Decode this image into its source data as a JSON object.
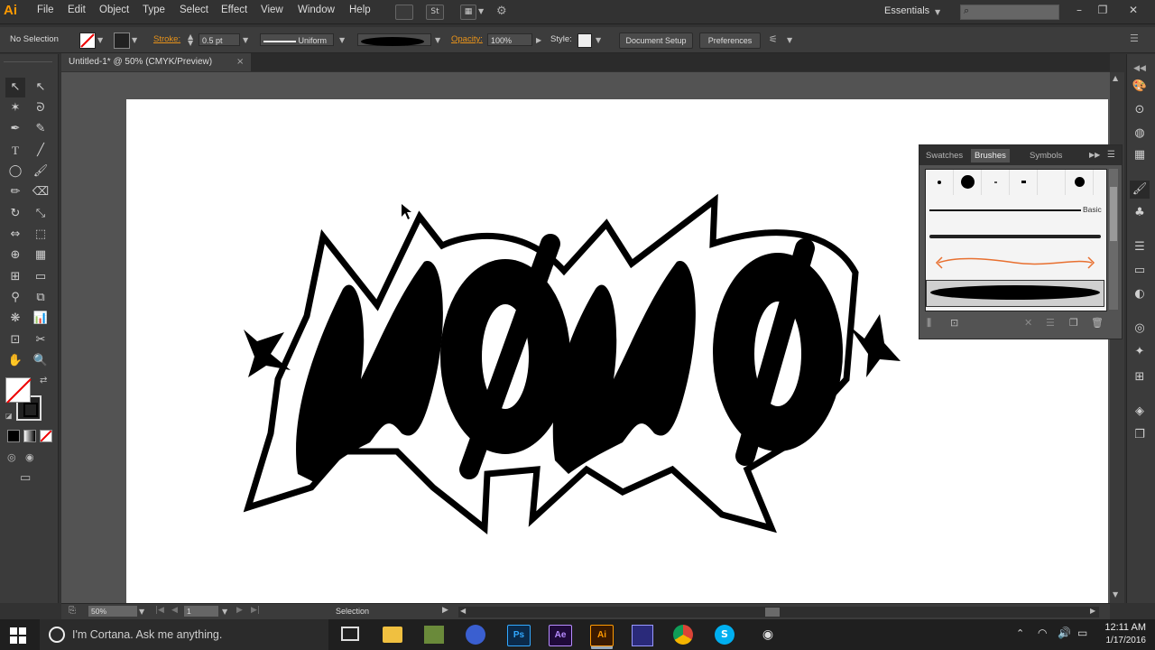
{
  "app": {
    "logo": "Ai"
  },
  "menu": [
    "File",
    "Edit",
    "Object",
    "Type",
    "Select",
    "Effect",
    "View",
    "Window",
    "Help"
  ],
  "toolbar": {
    "bridge_label": "St",
    "workspace": "Essentials"
  },
  "control_bar": {
    "selection_state": "No Selection",
    "stroke_label": "Stroke:",
    "stroke_weight": "0.5 pt",
    "stroke_profile": "Uniform",
    "opacity_label": "Opacity:",
    "opacity_value": "100%",
    "style_label": "Style:",
    "document_setup": "Document Setup",
    "preferences": "Preferences"
  },
  "document_tab": {
    "title": "Untitled-1* @ 50% (CMYK/Preview)",
    "close": "×"
  },
  "brushes_panel": {
    "tabs": [
      "Swatches",
      "Brushes",
      "Symbols"
    ],
    "active_tab": "Brushes",
    "basic_label": "Basic"
  },
  "status_bar": {
    "zoom": "50%",
    "artboard": "1",
    "tool": "Selection"
  },
  "taskbar": {
    "cortana_placeholder": "I'm Cortana. Ask me anything.",
    "apps": [
      "Ps",
      "Ae",
      "Ai"
    ],
    "time": "12:11 AM",
    "date": "1/17/2016"
  },
  "colors": {
    "accent": "#ff9a00",
    "stroke_orange": "#e8931a"
  },
  "artwork": {
    "text": "MØMØ"
  }
}
